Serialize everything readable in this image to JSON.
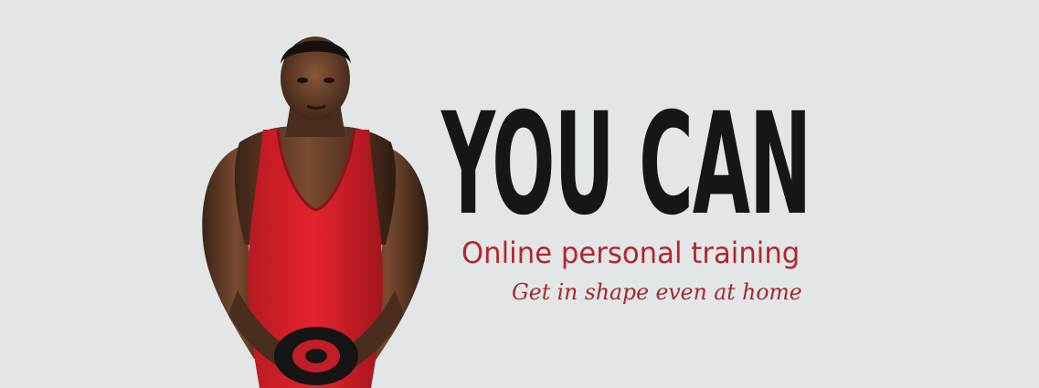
{
  "banner": {
    "headline": "YOU CAN",
    "subtitle": "Online personal training",
    "tagline": "Get in shape even at home",
    "colors": {
      "background": "#e2e6e7",
      "headline": "#141618",
      "accent": "#b3262a"
    },
    "image": "athlete-photo"
  }
}
